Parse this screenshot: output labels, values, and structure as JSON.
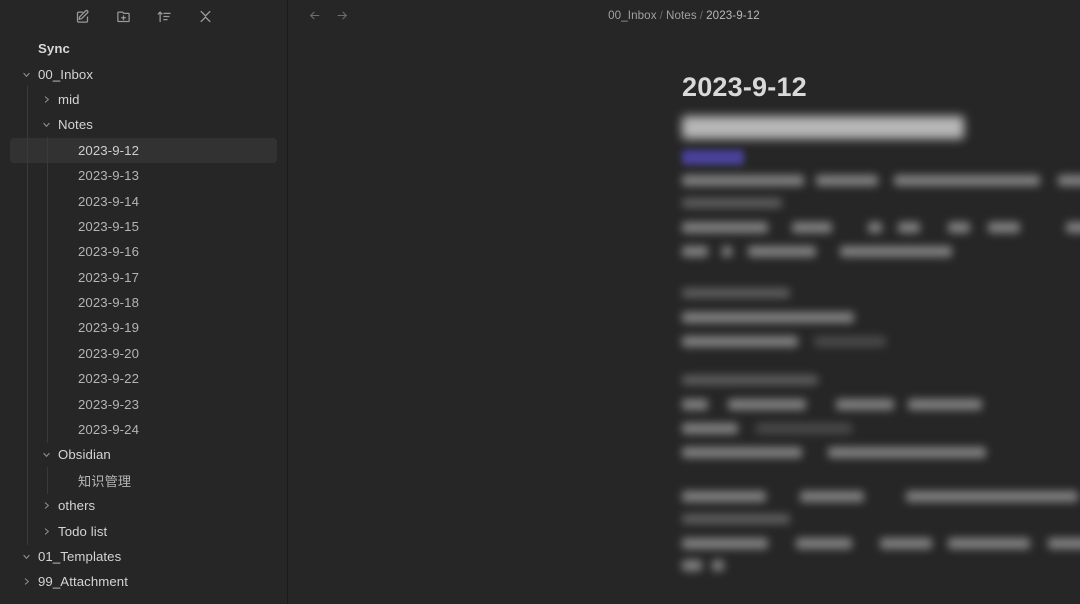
{
  "app": {
    "name": "Obsidian",
    "theme": "dark",
    "colors": {
      "sidebar_bg": "#262626",
      "main_bg": "#262626",
      "selected_row": "#323232",
      "text_primary": "#d4d4d4",
      "text_secondary": "#bbbbbb",
      "text_muted": "#8c8c8c",
      "accent_tag": "#4b43a0",
      "divider": "#1b1b1b"
    }
  },
  "sidebar": {
    "toolbar": [
      {
        "name": "new-note-icon",
        "label": "New note"
      },
      {
        "name": "new-folder-icon",
        "label": "New folder"
      },
      {
        "name": "sort-icon",
        "label": "Change sort order"
      },
      {
        "name": "collapse-all-icon",
        "label": "Collapse all"
      }
    ],
    "tree": [
      {
        "label": "Sync",
        "type": "folder",
        "depth": 0,
        "state": "none",
        "bold": true,
        "selected": false,
        "guides": []
      },
      {
        "label": "00_Inbox",
        "type": "folder",
        "depth": 0,
        "state": "expanded",
        "bold": false,
        "selected": false,
        "guides": []
      },
      {
        "label": "mid",
        "type": "folder",
        "depth": 1,
        "state": "collapsed",
        "bold": false,
        "selected": false,
        "guides": [
          17
        ]
      },
      {
        "label": "Notes",
        "type": "folder",
        "depth": 1,
        "state": "expanded",
        "bold": false,
        "selected": false,
        "guides": [
          17
        ]
      },
      {
        "label": "2023-9-12",
        "type": "file",
        "depth": 2,
        "state": "none",
        "bold": false,
        "selected": true,
        "guides": [
          17,
          37
        ]
      },
      {
        "label": "2023-9-13",
        "type": "file",
        "depth": 2,
        "state": "none",
        "bold": false,
        "selected": false,
        "guides": [
          17,
          37
        ]
      },
      {
        "label": "2023-9-14",
        "type": "file",
        "depth": 2,
        "state": "none",
        "bold": false,
        "selected": false,
        "guides": [
          17,
          37
        ]
      },
      {
        "label": "2023-9-15",
        "type": "file",
        "depth": 2,
        "state": "none",
        "bold": false,
        "selected": false,
        "guides": [
          17,
          37
        ]
      },
      {
        "label": "2023-9-16",
        "type": "file",
        "depth": 2,
        "state": "none",
        "bold": false,
        "selected": false,
        "guides": [
          17,
          37
        ]
      },
      {
        "label": "2023-9-17",
        "type": "file",
        "depth": 2,
        "state": "none",
        "bold": false,
        "selected": false,
        "guides": [
          17,
          37
        ]
      },
      {
        "label": "2023-9-18",
        "type": "file",
        "depth": 2,
        "state": "none",
        "bold": false,
        "selected": false,
        "guides": [
          17,
          37
        ]
      },
      {
        "label": "2023-9-19",
        "type": "file",
        "depth": 2,
        "state": "none",
        "bold": false,
        "selected": false,
        "guides": [
          17,
          37
        ]
      },
      {
        "label": "2023-9-20",
        "type": "file",
        "depth": 2,
        "state": "none",
        "bold": false,
        "selected": false,
        "guides": [
          17,
          37
        ]
      },
      {
        "label": "2023-9-22",
        "type": "file",
        "depth": 2,
        "state": "none",
        "bold": false,
        "selected": false,
        "guides": [
          17,
          37
        ]
      },
      {
        "label": "2023-9-23",
        "type": "file",
        "depth": 2,
        "state": "none",
        "bold": false,
        "selected": false,
        "guides": [
          17,
          37
        ]
      },
      {
        "label": "2023-9-24",
        "type": "file",
        "depth": 2,
        "state": "none",
        "bold": false,
        "selected": false,
        "guides": [
          17,
          37
        ]
      },
      {
        "label": "Obsidian",
        "type": "folder",
        "depth": 1,
        "state": "expanded",
        "bold": false,
        "selected": false,
        "guides": [
          17
        ]
      },
      {
        "label": "知识管理",
        "type": "file",
        "depth": 2,
        "state": "none",
        "bold": false,
        "selected": false,
        "guides": [
          17,
          37
        ]
      },
      {
        "label": "others",
        "type": "folder",
        "depth": 1,
        "state": "collapsed",
        "bold": false,
        "selected": false,
        "guides": [
          17
        ]
      },
      {
        "label": "Todo list",
        "type": "folder",
        "depth": 1,
        "state": "collapsed",
        "bold": false,
        "selected": false,
        "guides": [
          17
        ]
      },
      {
        "label": "01_Templates",
        "type": "folder",
        "depth": 0,
        "state": "expanded",
        "bold": false,
        "selected": false,
        "guides": []
      },
      {
        "label": "99_Attachment",
        "type": "folder",
        "depth": 0,
        "state": "collapsed",
        "bold": false,
        "selected": false,
        "guides": []
      }
    ]
  },
  "main": {
    "nav": {
      "back_label": "Navigate back",
      "forward_label": "Navigate forward"
    },
    "breadcrumb": {
      "parts": [
        "00_Inbox",
        "Notes",
        "2023-9-12"
      ],
      "separator": "/"
    },
    "note": {
      "title": "2023-9-12",
      "content_state": "blurred"
    }
  }
}
